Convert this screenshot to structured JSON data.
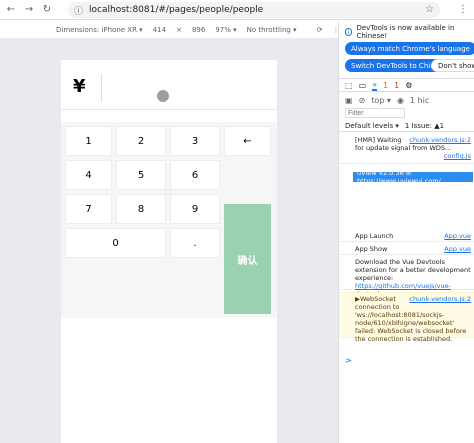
{
  "browser": {
    "url": "localhost:8081/#/pages/people/people"
  },
  "device_toolbar": {
    "dimensions": "Dimensions: iPhone XR ▾",
    "width": "414",
    "times": "×",
    "height": "896",
    "zoom": "97% ▾",
    "throttle": "No throttling ▾"
  },
  "app": {
    "currency_symbol": "¥",
    "keys": {
      "k1": "1",
      "k2": "2",
      "k3": "3",
      "back": "←",
      "k4": "4",
      "k5": "5",
      "k6": "6",
      "k7": "7",
      "k8": "8",
      "k9": "9",
      "k0": "0",
      "dot": ".",
      "confirm": "确认"
    }
  },
  "devtools": {
    "info_text": "DevTools is now available in Chinese!",
    "btn_match": "Always match Chrome's language",
    "btn_switch": "Switch DevTools to Chinese",
    "btn_dont": "Don't show ag",
    "tab_more": "»",
    "warn_count": "1",
    "err_count": "1",
    "context": "top ▾",
    "filter_placeholder": "Filter",
    "levels": "Default levels ▾",
    "issues": "1 Issue: ▲1",
    "hidden": "1 hic",
    "log1_text": "[HMR] Waiting for update signal from WDS...",
    "log1_src": "chunk-vendors.js:2",
    "log1_src2": "config.js",
    "vview": "uView V2.0.36 ✉ https://www.uviewui.com/",
    "log2_text": "App Launch",
    "log2_src": "App.vue",
    "log3_text": "App Show",
    "log3_src": "App.vue",
    "log4_text": "Download the Vue Devtools extension for a better development experience:",
    "log4_link": "https://github.com/vuejs/vue-devtools",
    "warn_text": "▶WebSocket connection to 'ws://localhost:8081/sockjs-node/610/xblhigne/websocket' failed: WebSocket is closed before the connection is established.",
    "warn_src": "chunk-vendors.js:2",
    "prompt": ">"
  }
}
